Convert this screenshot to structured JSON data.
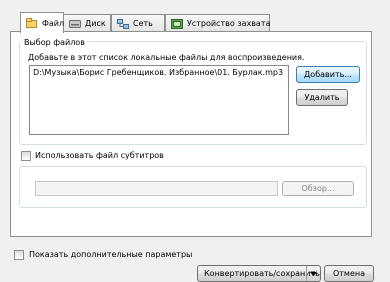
{
  "tabs": [
    {
      "label": "Файл",
      "icon": "file-icon",
      "active": true
    },
    {
      "label": "Диск",
      "icon": "disc-icon",
      "active": false
    },
    {
      "label": "Сеть",
      "icon": "network-icon",
      "active": false
    },
    {
      "label": "Устройство захвата",
      "icon": "capture-device-icon",
      "active": false
    }
  ],
  "file_selection": {
    "group_title": "Выбор файлов",
    "instruction": "Добавьте в этот список локальные файлы для воспроизведения.",
    "files": [
      "D:\\Музыка\\Борис Гребенщиков. Избранное\\01. Бурлак.mp3"
    ],
    "add_label": "Добавить...",
    "remove_label": "Удалить"
  },
  "subtitles": {
    "checkbox_label": "Использовать файл субтитров",
    "checked": false,
    "path_value": "",
    "browse_label": "Обзор..."
  },
  "footer": {
    "more_options_label": "Показать дополнительные параметры",
    "more_options_checked": false,
    "convert_label": "Конвертировать/сохранить",
    "cancel_label": "Отмена"
  },
  "colors": {
    "window_bg": "#f0f0f0",
    "panel_bg": "#ffffff",
    "border": "#8e8f8f",
    "focus_border": "#3c7fb1"
  }
}
